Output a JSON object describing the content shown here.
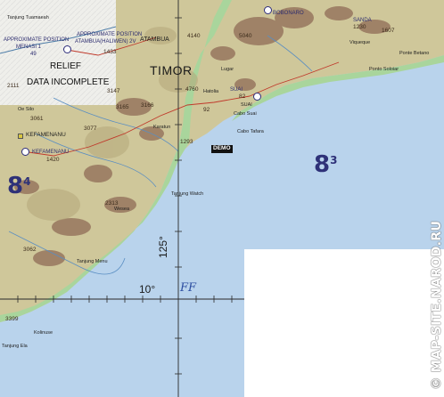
{
  "map": {
    "title": "TIMOR",
    "grid_cells": [
      {
        "main": "8",
        "sup": "4"
      },
      {
        "main": "8",
        "sup": "3"
      }
    ],
    "relief_notice": [
      "RELIEF",
      "DATA   INCOMPLETE"
    ],
    "places": {
      "tanjung_tuamaeah": "Tanjung Tuamaeah",
      "approx_menasi_1": "APPROXIMATE POSITION",
      "approx_menasi_2": "MENASI 1",
      "approx_menasi_3": "49",
      "approx_atambua_1": "APPROXIMATE POSITION",
      "approx_atambua_2": "ATAMBUA(HALIWEN) 2V",
      "atambua_elev": "1433",
      "atambua": "ATAMBUA",
      "pos_2111": "2111",
      "elev_3147": "3147",
      "elev_3165": "3165",
      "oe_silo": "Oe Silo",
      "elev_3061": "3061",
      "elev_3077": "3077",
      "kefamenanu": "KEFAMENANU",
      "kefamenanu_nr": "KEFAMENANU",
      "kefamenanu_elev": "1420",
      "elev_2313": "2313",
      "elev_3062": "3062",
      "elev_3166": "3166",
      "elev_3399": "3399",
      "elev_1293": "1293",
      "elev_4140": "4140",
      "elev_5040": "5040",
      "elev_4760": "4760",
      "tanjung_watch": "Tanjung Watch",
      "tanjung_menu": "Tanjung Menu",
      "tanjung_ela": "Tanjung Ela",
      "kolinuse": "Kolinuse",
      "wesea": "Wesea",
      "karatun": "Karatun",
      "suai_top": "SUAI",
      "suai_elev": "82",
      "suai": "SUAI",
      "suai_elev2": "92",
      "cabo_suai": "Cabo Suai",
      "cabo_tafara": "Cabo Tafara",
      "sanda": "SANDA",
      "sanda_elev": "1230",
      "elev_1607": "1607",
      "ponto_soloiar": "Ponto Soloiar",
      "ponto_betanai": "Ponte Betano",
      "viqueque": "Viqueque",
      "bobonaro": "BOBONARO",
      "lugar": "Lugar",
      "hatolia": "Hatolia",
      "longitude": "125",
      "latitude": "10",
      "ff": "FF",
      "demo": "DEMO"
    },
    "watermark": "© MAP-SITE.NAROD.RU",
    "colors": {
      "sea": "#b9d3ec",
      "lowland_green": "#a9d59c",
      "upland": "#cfc79a",
      "mountain": "#8f6b57",
      "grid_lines": "#2a2a2a",
      "grid_label": "#2e3178",
      "blank_panel": "#ffffff"
    }
  }
}
